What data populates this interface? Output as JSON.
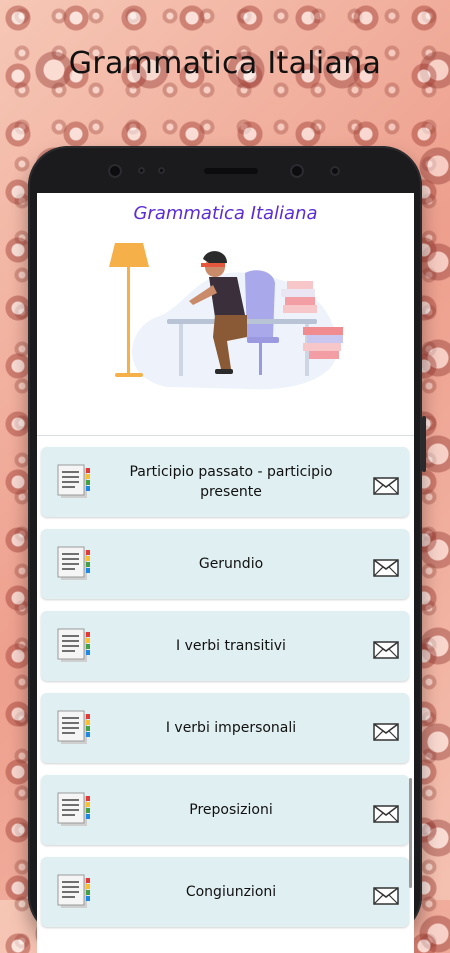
{
  "promo": {
    "title": "Grammatica Italiana"
  },
  "app": {
    "title": "Grammatica Italiana"
  },
  "topics": [
    {
      "label": "Participio passato - participio presente"
    },
    {
      "label": "Gerundio"
    },
    {
      "label": "I verbi transitivi"
    },
    {
      "label": "I verbi impersonali"
    },
    {
      "label": "Preposizioni"
    },
    {
      "label": "Congiunzioni"
    }
  ],
  "icons": {
    "topic_icon": "document-icon",
    "action_icon": "envelope-icon"
  },
  "colors": {
    "title": "#5b2bd6",
    "card_bg": "#e0eff2",
    "phone": "#1b1b1d"
  }
}
